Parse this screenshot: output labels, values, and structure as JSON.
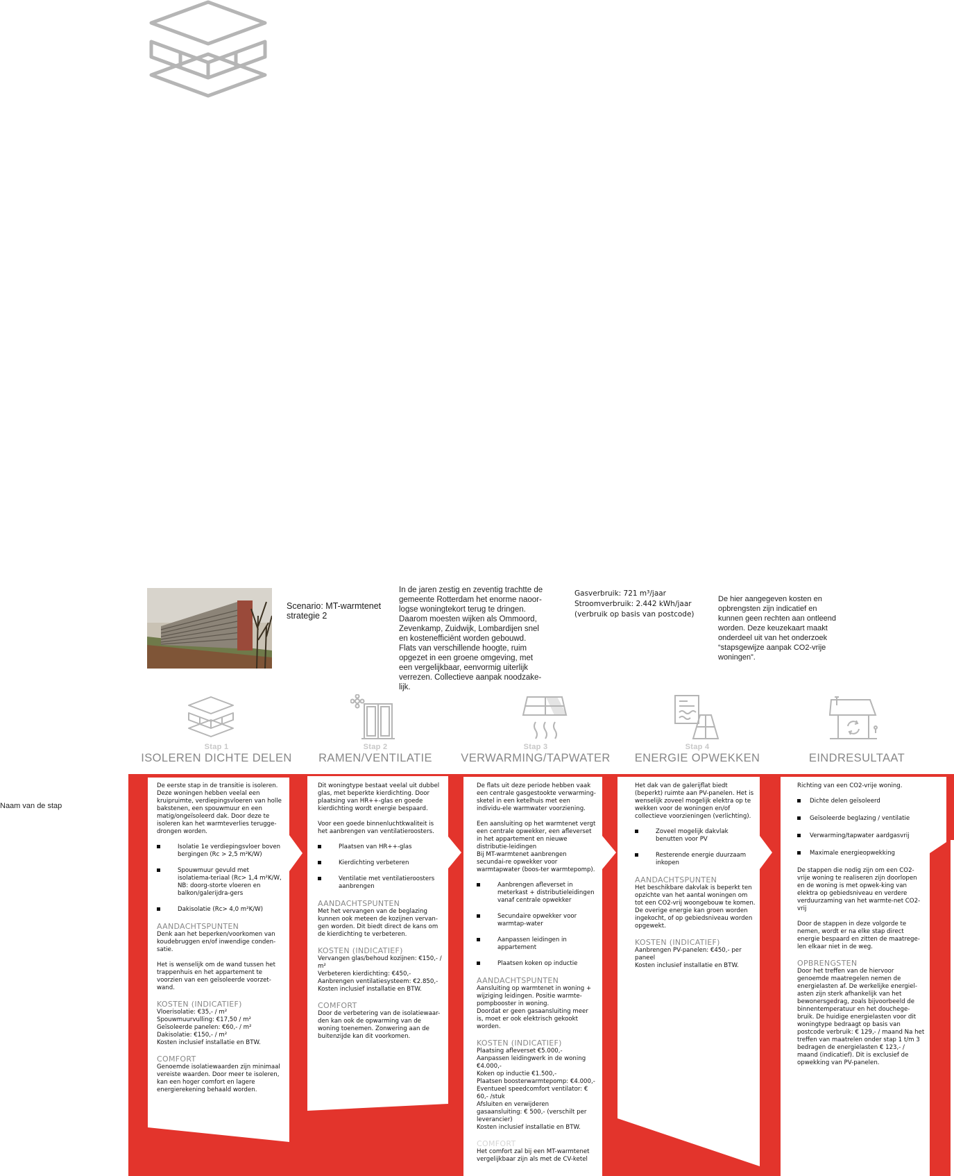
{
  "scenario": "Scenario: MT-warmtenet\nstrategie 2",
  "intro": "In de jaren zestig en zeventig trachtte de\ngemeente Rotterdam het enorme naoor-\nlogse woningtekort terug te dringen.\nDaarom moesten wijken als Ommoord,\nZevenkamp, Zuidwijk, Lombardijen snel\nen kostenefficiënt worden gebouwd.\nFlats van verschillende hoogte, ruim\nopgezet in een groene omgeving, met\neen vergelijkbaar, eenvormig uiterlijk\nverrezen. Collectieve aanpak noodzake-\nlijk.",
  "usage": {
    "gas": "Gasverbruik: 721 m³/jaar",
    "power": "Stroomverbruik: 2.442 kWh/jaar",
    "note": "(verbruik op basis van postcode)"
  },
  "disclaimer": "De hier aangegeven kosten en\nopbrengsten zijn indicatief en\nkunnen geen rechten aan ontleend\nworden. Deze keuzekaart maakt\nonderdeel uit van het onderzoek\n“stapsgewijze aanpak CO2-vrije\nwoningen”.",
  "side_label": "Naam van de stap",
  "steps": [
    {
      "label": "Stap 1",
      "title": "ISOLEREN DICHTE DELEN",
      "icon": "insulation-layers-icon"
    },
    {
      "label": "Stap 2",
      "title": "RAMEN/VENTILATIE",
      "icon": "window-ventilation-icon"
    },
    {
      "label": "Stap 3",
      "title": "VERWARMING/TAPWATER",
      "icon": "heating-tapwater-icon"
    },
    {
      "label": "Stap 4",
      "title": "ENERGIE OPWEKKEN",
      "icon": "solar-energy-icon"
    },
    {
      "label": "",
      "title": "EINDRESULTAAT",
      "icon": "house-result-icon"
    }
  ],
  "col1": {
    "intro": "De eerste stap in de transitie is isoleren. Deze woningen hebben veelal een kruipruimte, verdiepingsvloeren van holle bakstenen, een spouwmuur en een matig/ongeïsoleerd dak. Door deze te isoleren kan het warmteverlies terugge-drongen worden.",
    "bullets": [
      "Isolatie 1e verdiepingsvloer boven bergingen (Rc > 2,5 m²K/W)",
      "Spouwmuur gevuld met isolatiema-teriaal (Rc> 1,4 m²K/W, NB: doorg-storte vloeren en balkon/galerijdra-gers",
      "Dakisolatie  (Rc> 4,0 m²K/W)"
    ],
    "h1": "AANDACHTSPUNTEN",
    "a1": "Denk aan het beperken/voorkomen van koudebruggen en/of inwendige conden-satie.",
    "a2": "Het is wenselijk om de wand tussen het trappenhuis en het appartement te voorzien van een geïsoleerde voorzet-wand.",
    "h2": "KOSTEN (INDICATIEF)",
    "k": "Vloerisolatie: €35,- / m²\nSpouwmuurvulling: €17,50 / m²\nGeïsoleerde panelen: €60,- / m²\nDakisolatie: €150,- / m²\nKosten inclusief installatie en BTW.",
    "h3": "COMFORT",
    "c": "Genoemde isolatiewaarden zijn minimaal vereiste waarden. Door meer te isoleren, kan een hoger comfort en lagere energierekening behaald worden."
  },
  "col2": {
    "intro": "Dit woningtype bestaat veelal uit dubbel glas, met beperkte kierdichting. Door plaatsing van HR++-glas en goede kierdichting wordt energie bespaard.",
    "intro2": "Voor een goede binnenluchtkwaliteit is het aanbrengen van ventilatieroosters.",
    "bullets": [
      "Plaatsen van HR++-glas",
      "Kierdichting verbeteren",
      "Ventilatie met ventilatieroosters aanbrengen"
    ],
    "h1": "AANDACHTSPUNTEN",
    "a1": "Met het vervangen van de beglazing kunnen ook meteen de kozijnen vervan-gen worden. Dit biedt direct de kans om de kierdichting te verbeteren.",
    "h2": "KOSTEN (INDICATIEF)",
    "k": "Vervangen glas/behoud kozijnen: €150,- / m²\nVerbeteren kierdichting: €450,-\nAanbrengen ventilatiesysteem: €2.850,-\nKosten inclusief installatie en BTW.",
    "h3": "COMFORT",
    "c": "Door de verbetering van de isolatiewaar-den kan ook de opwarming van de woning toenemen. Zonwering aan de buitenzijde kan dit voorkomen."
  },
  "col3": {
    "intro": "De flats uit deze periode hebben vaak een centrale gasgestookte verwarming-sketel in een ketelhuis met een individu-ele warmwater voorziening.",
    "intro2": "Een aansluiting op het warmtenet vergt een centrale opwekker, een afleverset in het appartement en nieuwe distributie-leidingen\nBij MT-warmtenet aanbrengen secundai-re opwekker voor warmtapwater (boos-ter warmtepomp).",
    "bullets": [
      "Aanbrengen afleverset in meterkast + distributieleidingen vanaf centrale opwekker",
      "Secundaire opwekker voor warmtap-water",
      "Aanpassen leidingen in appartement",
      "Plaatsen koken op inductie"
    ],
    "h1": "AANDACHTSPUNTEN",
    "a1": "Aansluiting op warmtenet in woning + wijziging leidingen. Positie warmte-pompbooster in woning.\nDoordat er geen gasaansluiting meer is, moet er ook elektrisch gekookt worden.",
    "h2": "KOSTEN (INDICATIEF)",
    "k": "Plaatsing afleverset €5.000,-\nAanpassen leidingwerk in de woning €4.000,-\nKoken op inductie €1.500,-\nPlaatsen boosterwarmtepomp: €4.000,-\nEventueel speedcomfort ventilator: € 60,- /stuk\nAfsluiten en verwijderen gasaansluiting: € 500,- (verschilt per leverancier)\nKosten inclusief installatie en BTW.",
    "h3": "COMFORT",
    "c": "Het comfort zal bij een MT-warmtenet vergelijkbaar zijn als met de CV-ketel"
  },
  "col4": {
    "intro": "Het dak van de galerijflat biedt (beperkt) ruimte aan PV-panelen. Het is wenselijk zoveel mogelijk elektra op te wekken voor de woningen en/of collectieve voorzieningen (verlichting).",
    "bullets": [
      "Zoveel mogelijk dakvlak benutten voor PV",
      "Resterende energie duurzaam inkopen"
    ],
    "h1": "AANDACHTSPUNTEN",
    "a1": "Het beschikbare dakvlak is beperkt ten opzichte van het aantal woningen om tot een CO2-vrij woongebouw te komen. De overige energie kan groen worden ingekocht, of op gebiedsniveau worden opgewekt.",
    "h2": "KOSTEN (INDICATIEF)",
    "k": "Aanbrengen PV-panelen: €450,- per paneel\nKosten inclusief installatie en BTW."
  },
  "col5": {
    "intro": "Richting van een CO2-vrije woning.",
    "bullets": [
      "Dichte delen geïsoleerd",
      "Geïsoleerde beglazing / ventilatie",
      "Verwarming/tapwater aardgasvrij",
      "Maximale energieopwekking"
    ],
    "p1": "De stappen die nodig zijn om een CO2-vrije woning te realiseren zijn doorlopen en de woning is met opwek-king van elektra op gebiedsniveau  en verdere verduurzaming van het warmte-net CO2-vrij",
    "p2": "Door de stappen in deze volgorde te nemen, wordt er na elke stap direct energie bespaard en zitten de maatrege-len elkaar niet in de weg.",
    "h1": "OPBRENGSTEN",
    "o": "Door het treffen van de hiervoor genoemde maatregelen nemen de energielasten af. De werkelijke energiel-asten zijn sterk afhankelijk van het bewonersgedrag, zoals bijvoorbeeld de binnentemperatuur en het douchege-bruik. De huidige energielasten voor dit woningtype bedraagt op basis van postcode verbruik: € 129,- / maand Na het treffen van maatrelen onder stap 1 t/m 3 bedragen de energielasten € 123,- / maand (indicatief). Dit is exclusief de opwekking van PV-panelen."
  },
  "colors": {
    "accent": "#e3342c",
    "icon": "#b5b5b5",
    "title": "#888888"
  }
}
